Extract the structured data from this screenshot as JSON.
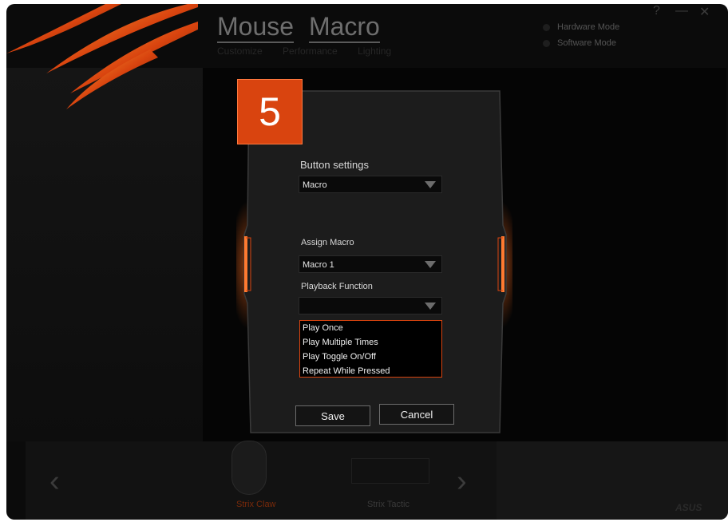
{
  "app": {
    "tabs": [
      "Mouse",
      "Macro"
    ],
    "subnav": [
      "Customize",
      "Performance",
      "Lighting"
    ],
    "modes": [
      "Hardware Mode",
      "Software Mode"
    ],
    "window_controls": {
      "help": "?",
      "minimize": "—",
      "close": "✕"
    }
  },
  "devices": [
    "Strix Claw",
    "Strix Tactic"
  ],
  "brand": "ASUS",
  "dialog": {
    "step": "5",
    "button_settings_label": "Button settings",
    "button_settings_value": "Macro",
    "assign_macro_label": "Assign Macro",
    "assign_macro_value": "Macro 1",
    "playback_label": "Playback Function",
    "playback_value": "",
    "playback_options": [
      "Play Once",
      "Play Multiple Times",
      "Play Toggle On/Off",
      "Repeat While Pressed"
    ],
    "save_label": "Save",
    "cancel_label": "Cancel"
  },
  "colors": {
    "accent": "#d9440f",
    "glow": "#ff6a1a"
  }
}
